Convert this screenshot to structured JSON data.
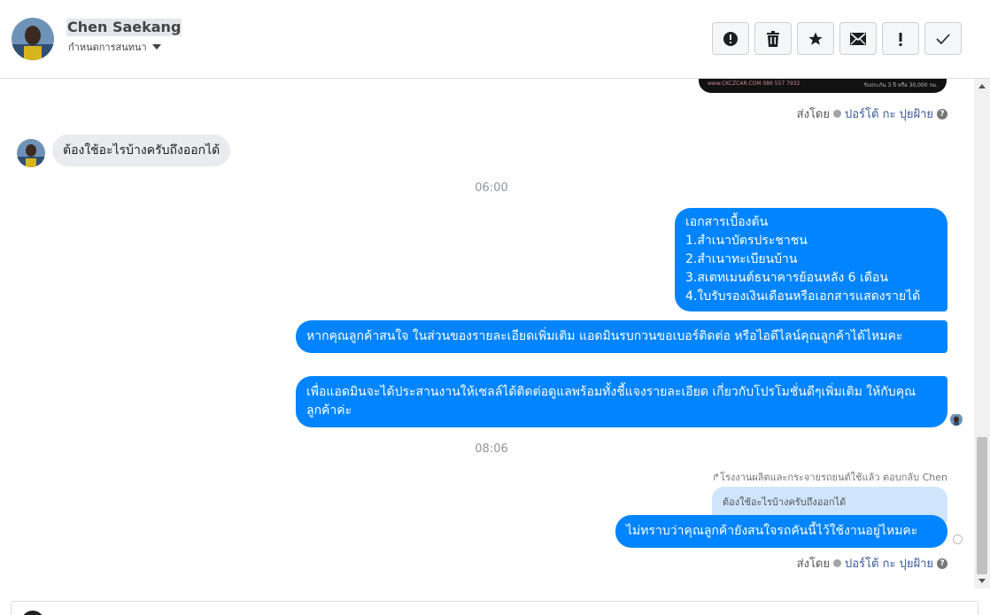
{
  "header": {
    "contact_name": "Chen Saekang",
    "conversation_settings": "กำหนดการสนทนา",
    "toolbar": [
      {
        "name": "report-spam-button",
        "icon": "alert-circle-icon"
      },
      {
        "name": "delete-button",
        "icon": "trash-icon"
      },
      {
        "name": "star-button",
        "icon": "star-icon"
      },
      {
        "name": "mark-unread-button",
        "icon": "envelope-icon"
      },
      {
        "name": "follow-up-button",
        "icon": "exclamation-icon"
      },
      {
        "name": "mark-done-button",
        "icon": "checkmark-icon"
      }
    ]
  },
  "messages": {
    "image_caption_left": "www.CKCZCAR.COM 086 557 7932",
    "image_caption_right": "รับประกัน 3 ปี หรือ 30,000 กม.",
    "sent_by_1": {
      "prefix": "ส่งโดย",
      "page": "ปอร์โต้ กะ ปุยฝ้าย"
    },
    "incoming_1": "ต้องใช้อะไรบ้างครับถึงออกได้",
    "time_1": "06:00",
    "outgoing_1": [
      "เอกสารเบื้องต้น",
      "1.สำเนาบัตรประชาชน",
      "2.สำเนาทะเบียนบ้าน",
      "3.สเตทเมนต์ธนาคารย้อนหลัง 6 เดือน",
      "4.ใบรับรองเงินเดือนหรือเอกสารแสดงรายได้"
    ],
    "outgoing_2": "หากคุณลูกค้าสนใจ ในส่วนของรายละเอียดเพิ่มเติม แอดมินรบกวนขอเบอร์ติดต่อ หรือไอดีไลน์คุณลูกค้าได้ไหมคะ",
    "outgoing_3": "เพื่อแอดมินจะได้ประสานงานให้เซลล์ได้ติดต่อดูแลพร้อมทั้งชี้แจงรายละเอียด เกี่ยวกับโปรโมชั่นดีๆเพิ่มเติม ให้กับคุณลูกค้าค่ะ",
    "time_2": "08:06",
    "reply_note": "โรงงานผลิตและกระจายรถยนต์ใช้แล้ว ตอบกลับ Chen",
    "reply_quote": "ต้องใช้อะไรบ้างครับถึงออกได้",
    "outgoing_4": "ไม่ทราบว่าคุณลูกค้ายังสนใจรถคันนี้ไว้ใช้งานอยู่ไหมคะ",
    "sent_by_2": {
      "prefix": "ส่งโดย",
      "page": "ปอร์โต้ กะ ปุยฝ้าย"
    }
  },
  "colors": {
    "outgoing_bubble": "#0084ff",
    "incoming_bubble": "#e9ebee",
    "reply_quote": "#cfe5fb"
  }
}
